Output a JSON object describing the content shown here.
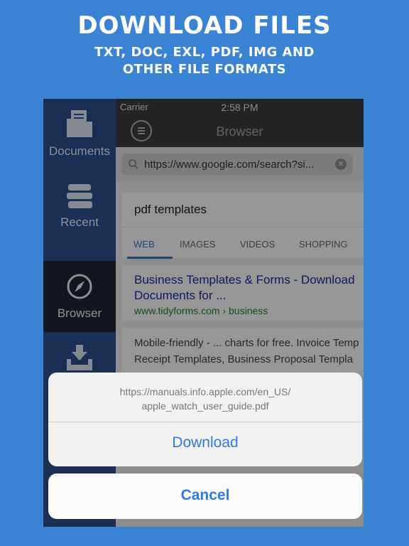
{
  "promo": {
    "headline": "DOWNLOAD FILES",
    "subline1": "TXT, DOC, EXL, PDF, IMG AND",
    "subline2": "OTHER FILE FORMATS"
  },
  "status": {
    "carrier": "Carrier",
    "time": "2:58 PM"
  },
  "nav": {
    "title": "Browser"
  },
  "sidebar": {
    "items": [
      {
        "label": "Documents",
        "icon": "folder-icon"
      },
      {
        "label": "Recent",
        "icon": "books-icon"
      },
      {
        "label": "Browser",
        "icon": "compass-icon"
      },
      {
        "label": "",
        "icon": "download-tray-icon"
      }
    ]
  },
  "urlbar": {
    "url": "https://www.google.com/search?si..."
  },
  "search": {
    "query": "pdf templates",
    "tabs": [
      "WEB",
      "IMAGES",
      "VIDEOS",
      "SHOPPING"
    ]
  },
  "results": [
    {
      "title1": "Business Templates & Forms - Download",
      "title2": "Documents for ...",
      "url": "www.tidyforms.com › business"
    },
    {
      "line1": "Mobile-friendly - ... charts for free. Invoice Temp",
      "line2": "Receipt Templates, Business Proposal Templa"
    }
  ],
  "sheet": {
    "message1": "https://manuals.info.apple.com/en_US/",
    "message2": "apple_watch_user_guide.pdf",
    "download_label": "Download",
    "cancel_label": "Cancel"
  },
  "colors": {
    "background": "#3a82d4",
    "accent": "#2f7ae5",
    "sidebar": "#2c4c8a"
  }
}
